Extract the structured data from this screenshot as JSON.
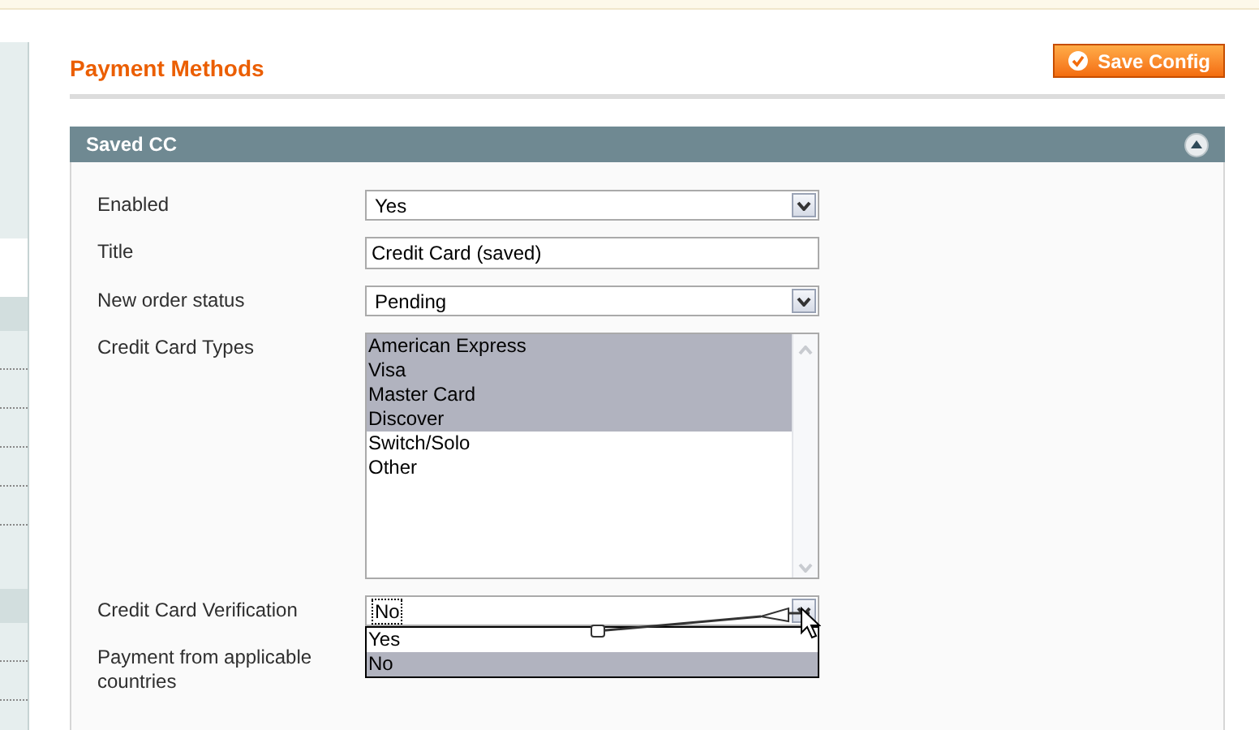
{
  "page_title": "Payment Methods",
  "save_button": "Save Config",
  "section": {
    "title": "Saved CC",
    "expanded": true,
    "fields": [
      {
        "kind": "select",
        "label": "Enabled",
        "value": "Yes"
      },
      {
        "kind": "text",
        "label": "Title",
        "value": "Credit Card (saved)"
      },
      {
        "kind": "select",
        "label": "New order status",
        "value": "Pending"
      },
      {
        "kind": "multiselect",
        "label": "Credit Card Types",
        "options": [
          {
            "label": "American Express",
            "selected": true
          },
          {
            "label": "Visa",
            "selected": true
          },
          {
            "label": "Master Card",
            "selected": true
          },
          {
            "label": "Discover",
            "selected": true
          },
          {
            "label": "Switch/Solo",
            "selected": false
          },
          {
            "label": "Other",
            "selected": false
          }
        ]
      },
      {
        "kind": "dropdown",
        "label": "Credit Card Verification",
        "value": "No",
        "open": true,
        "options": [
          {
            "label": "Yes",
            "selected": false
          },
          {
            "label": "No",
            "selected": true
          }
        ]
      },
      {
        "kind": "covered",
        "label": "Payment from applicable countries"
      }
    ]
  }
}
